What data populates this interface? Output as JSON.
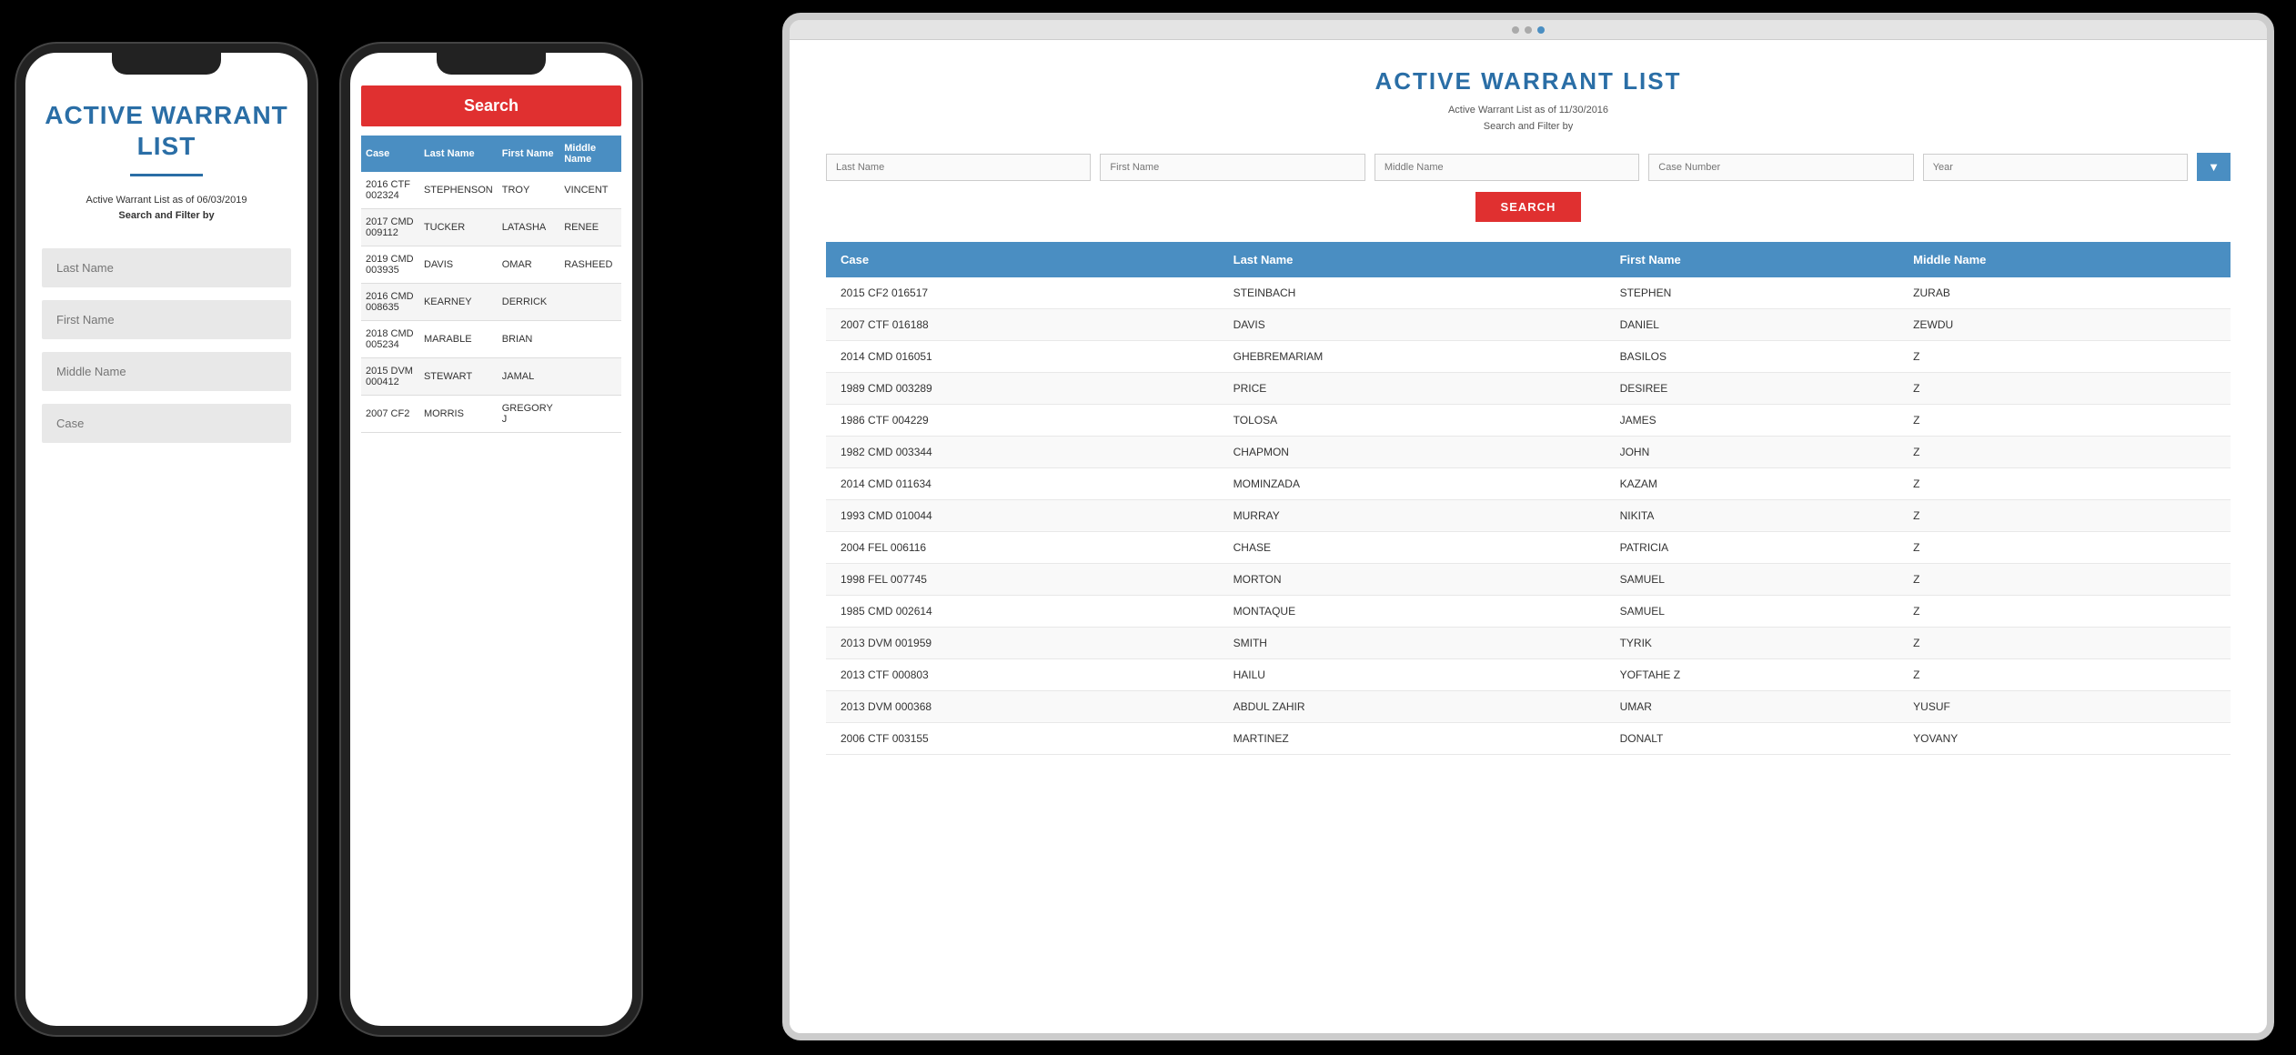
{
  "phone1": {
    "title": "ACTIVE WARRANT LIST",
    "divider": true,
    "subtitle_line1": "Active Warrant List as of 06/03/2019",
    "subtitle_line2": "Search and Filter by",
    "fields": [
      {
        "label": "Last Name",
        "placeholder": "Last Name"
      },
      {
        "label": "First Name",
        "placeholder": "First Name"
      },
      {
        "label": "Middle Name",
        "placeholder": "Middle Name"
      },
      {
        "label": "Case",
        "placeholder": "Case"
      }
    ]
  },
  "phone2": {
    "search_label": "Search",
    "table": {
      "headers": [
        "Case",
        "Last Name",
        "First Name",
        "Middle Name"
      ],
      "rows": [
        {
          "case": "2016 CTF 002324",
          "last": "STEPHENSON",
          "first": "TROY",
          "middle": "VINCENT"
        },
        {
          "case": "2017 CMD 009112",
          "last": "TUCKER",
          "first": "LATASHA",
          "middle": "RENEE"
        },
        {
          "case": "2019 CMD 003935",
          "last": "DAVIS",
          "first": "OMAR",
          "middle": "RASHEED"
        },
        {
          "case": "2016 CMD 008635",
          "last": "KEARNEY",
          "first": "DERRICK",
          "middle": ""
        },
        {
          "case": "2018 CMD 005234",
          "last": "MARABLE",
          "first": "BRIAN",
          "middle": ""
        },
        {
          "case": "2015 DVM 000412",
          "last": "STEWART",
          "first": "JAMAL",
          "middle": ""
        },
        {
          "case": "2007 CF2",
          "last": "MORRIS",
          "first": "GREGORY J",
          "middle": ""
        }
      ]
    }
  },
  "tablet": {
    "title": "ACTIVE WARRANT LIST",
    "subtitle_line1": "Active Warrant List as of 11/30/2016",
    "subtitle_line2": "Search and Filter by",
    "filters": {
      "last_name_placeholder": "Last Name",
      "first_name_placeholder": "First Name",
      "middle_name_placeholder": "Middle Name",
      "case_number_placeholder": "Case Number",
      "year_placeholder": "Year"
    },
    "search_btn_label": "SEARCH",
    "table": {
      "headers": [
        "Case",
        "Last Name",
        "First Name",
        "Middle Name"
      ],
      "rows": [
        {
          "case": "2015 CF2 016517",
          "last": "STEINBACH",
          "first": "STEPHEN",
          "middle": "ZURAB"
        },
        {
          "case": "2007 CTF 016188",
          "last": "DAVIS",
          "first": "DANIEL",
          "middle": "ZEWDU"
        },
        {
          "case": "2014 CMD 016051",
          "last": "GHEBREMARIAM",
          "first": "BASILOS",
          "middle": "Z"
        },
        {
          "case": "1989 CMD 003289",
          "last": "PRICE",
          "first": "DESIREE",
          "middle": "Z"
        },
        {
          "case": "1986 CTF 004229",
          "last": "TOLOSA",
          "first": "JAMES",
          "middle": "Z"
        },
        {
          "case": "1982 CMD 003344",
          "last": "CHAPMON",
          "first": "JOHN",
          "middle": "Z"
        },
        {
          "case": "2014 CMD 011634",
          "last": "MOMINZADA",
          "first": "KAZAM",
          "middle": "Z"
        },
        {
          "case": "1993 CMD 010044",
          "last": "MURRAY",
          "first": "NIKITA",
          "middle": "Z"
        },
        {
          "case": "2004 FEL 006116",
          "last": "CHASE",
          "first": "PATRICIA",
          "middle": "Z"
        },
        {
          "case": "1998 FEL 007745",
          "last": "MORTON",
          "first": "SAMUEL",
          "middle": "Z"
        },
        {
          "case": "1985 CMD 002614",
          "last": "MONTAQUE",
          "first": "SAMUEL",
          "middle": "Z"
        },
        {
          "case": "2013 DVM 001959",
          "last": "SMITH",
          "first": "TYRIK",
          "middle": "Z"
        },
        {
          "case": "2013 CTF 000803",
          "last": "HAILU",
          "first": "YOFTAHE Z",
          "middle": "Z"
        },
        {
          "case": "2013 DVM 000368",
          "last": "ABDUL ZAHIR",
          "first": "UMAR",
          "middle": "YUSUF"
        },
        {
          "case": "2006 CTF 003155",
          "last": "MARTINEZ",
          "first": "DONALT",
          "middle": "YOVANY"
        }
      ]
    }
  }
}
